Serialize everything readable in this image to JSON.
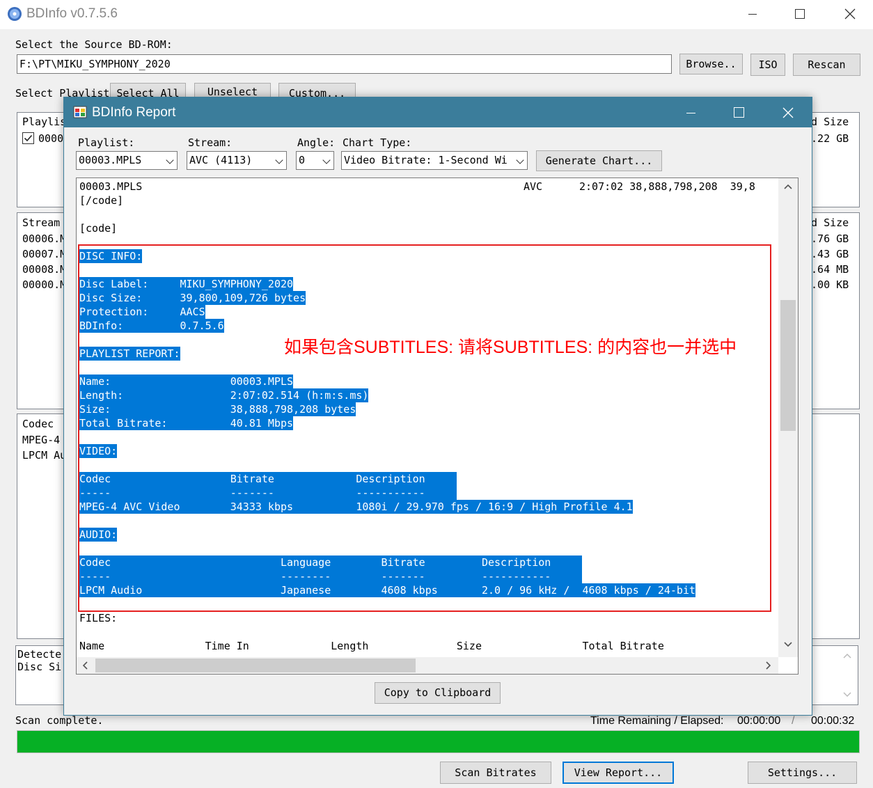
{
  "main_window": {
    "title": "BDInfo v0.7.5.6",
    "source_label": "Select the Source BD-ROM:",
    "source_path": "F:\\PT\\MIKU_SYMPHONY_2020",
    "browse_button": "Browse..",
    "iso_button": "ISO",
    "rescan_button": "Rescan",
    "playlist_label": "Select Playlist",
    "select_all_button": "Select All",
    "unselect_button": "Unselect",
    "custom_button": "Custom...",
    "playlist_panel": {
      "header_left": "Playlis",
      "header_right": "ed Size",
      "row_id": "0000",
      "row_size": "5.22 GB",
      "row_checked": true
    },
    "stream_panel": {
      "header_left": "Stream",
      "header_right": "ed Size",
      "rows": [
        {
          "name": "00006.M",
          "size": "2.76 GB"
        },
        {
          "name": "00007.M",
          "size": "3.43 GB"
        },
        {
          "name": "00008.M",
          "size": "9.64 MB"
        },
        {
          "name": "00000.M",
          "size": "6.00 KB"
        }
      ]
    },
    "codec_panel": {
      "header": "Codec",
      "rows": [
        "MPEG-4",
        "LPCM Au"
      ]
    },
    "detected_panel": {
      "line1": "Detecte",
      "line2": "Disc Si"
    },
    "status_text": "Scan complete.",
    "time_label": "Time Remaining / Elapsed:",
    "time_remaining": "00:00:00",
    "time_separator": "/",
    "time_elapsed": "00:00:32",
    "progress": 1.0,
    "progress_color": "#06b025",
    "scan_bitrates_button": "Scan Bitrates",
    "view_report_button": "View Report...",
    "settings_button": "Settings..."
  },
  "report_window": {
    "title": "BDInfo Report",
    "title_bar_color": "#3b7d9b",
    "playlist_label": "Playlist:",
    "playlist_value": "00003.MPLS",
    "stream_label": "Stream:",
    "stream_value": "AVC (4113)",
    "angle_label": "Angle:",
    "angle_value": "0",
    "chart_type_label": "Chart Type:",
    "chart_type_value": "Video Bitrate: 1-Second Wi",
    "generate_chart_button": "Generate Chart...",
    "copy_button": "Copy to Clipboard",
    "annotation": "如果包含SUBTITLES: 请将SUBTITLES: 的内容也一并选中",
    "annotation_color": "#ff0000",
    "selection_color": "#0078d7",
    "report_lines": [
      {
        "segments": [
          "00003.MPLS",
          "AVC",
          "2:07:02 38,888,798,208  39,8"
        ],
        "hl": false
      },
      {
        "segments": [
          "[/code]"
        ],
        "hl": false
      },
      {
        "segments": [
          ""
        ],
        "hl": false
      },
      {
        "segments": [
          "[code]"
        ],
        "hl": false
      },
      {
        "segments": [
          ""
        ],
        "hl": false
      },
      {
        "segments": [
          "DISC INFO:"
        ],
        "hl": true
      },
      {
        "segments": [
          ""
        ],
        "hl": false
      },
      {
        "segments": [
          "Disc Label:     MIKU_SYMPHONY_2020"
        ],
        "hl": true
      },
      {
        "segments": [
          "Disc Size:      39,800,109,726 bytes"
        ],
        "hl": true
      },
      {
        "segments": [
          "Protection:     AACS"
        ],
        "hl": true
      },
      {
        "segments": [
          "BDInfo:         0.7.5.6"
        ],
        "hl": true
      },
      {
        "segments": [
          ""
        ],
        "hl": false
      },
      {
        "segments": [
          "PLAYLIST REPORT:"
        ],
        "hl": true
      },
      {
        "segments": [
          ""
        ],
        "hl": false
      },
      {
        "segments": [
          "Name:                   00003.MPLS"
        ],
        "hl": true
      },
      {
        "segments": [
          "Length:                 2:07:02.514 (h:m:s.ms)"
        ],
        "hl": true
      },
      {
        "segments": [
          "Size:                   38,888,798,208 bytes"
        ],
        "hl": true
      },
      {
        "segments": [
          "Total Bitrate:          40.81 Mbps"
        ],
        "hl": true
      },
      {
        "segments": [
          ""
        ],
        "hl": false
      },
      {
        "segments": [
          "VIDEO:"
        ],
        "hl": true
      },
      {
        "segments": [
          ""
        ],
        "hl": false
      },
      {
        "segments": [
          "Codec                   Bitrate             Description     "
        ],
        "hl": true
      },
      {
        "segments": [
          "-----                   -------             -----------     "
        ],
        "hl": true
      },
      {
        "segments": [
          "MPEG-4 AVC Video        34333 kbps          1080i / 29.970 fps / 16:9 / High Profile 4.1"
        ],
        "hl": true
      },
      {
        "segments": [
          ""
        ],
        "hl": false
      },
      {
        "segments": [
          "AUDIO:"
        ],
        "hl": true
      },
      {
        "segments": [
          ""
        ],
        "hl": false
      },
      {
        "segments": [
          "Codec                           Language        Bitrate         Description     "
        ],
        "hl": true
      },
      {
        "segments": [
          "-----                           --------        -------         -----------     "
        ],
        "hl": true
      },
      {
        "segments": [
          "LPCM Audio                      Japanese        4608 kbps       2.0 / 96 kHz /  4608 kbps / 24-bit"
        ],
        "hl": true
      },
      {
        "segments": [
          ""
        ],
        "hl": false
      },
      {
        "segments": [
          "FILES:"
        ],
        "hl": false
      },
      {
        "segments": [
          ""
        ],
        "hl": false
      },
      {
        "segments": [
          "Name                Time In             Length              Size                Total Bitrate"
        ],
        "hl": false
      }
    ]
  },
  "icons": {
    "app": "disc-icon",
    "report": "report-window-icon",
    "minimize": "minimize-icon",
    "maximize": "maximize-icon",
    "close": "close-icon"
  }
}
